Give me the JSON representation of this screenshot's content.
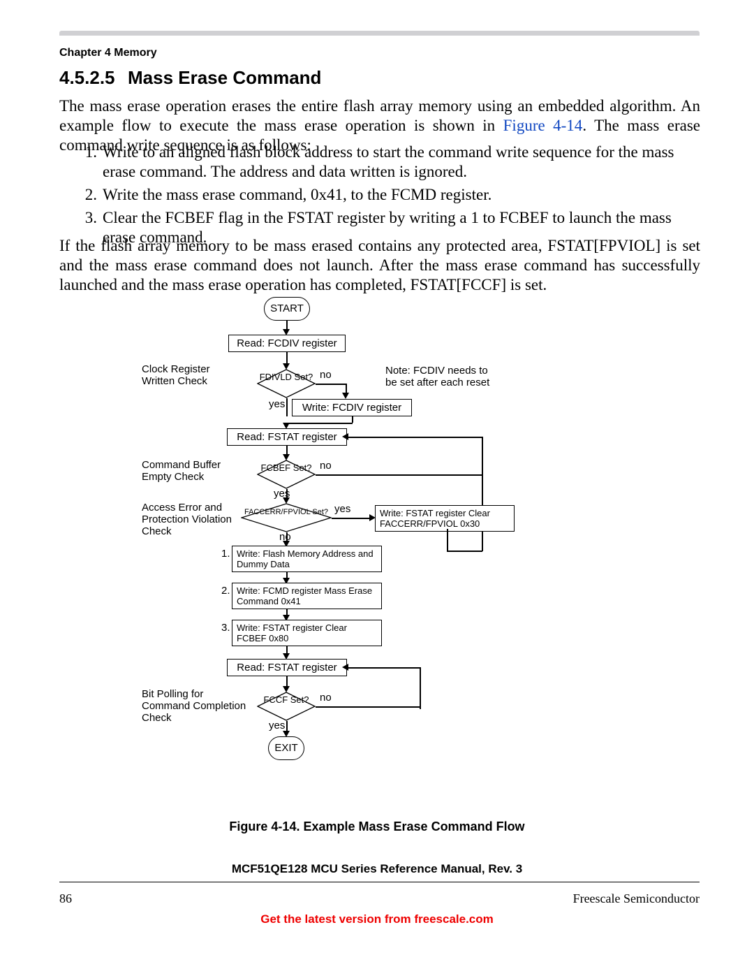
{
  "chapter_header": "Chapter 4 Memory",
  "section": {
    "number": "4.5.2.5",
    "title": "Mass Erase Command"
  },
  "para1_a": "The mass erase operation erases the entire flash array memory using an embedded algorithm. An example flow to execute the mass erase operation is shown in ",
  "para1_figref": "Figure 4-14",
  "para1_b": ". The mass erase command write sequence is as follows:",
  "list": {
    "1": "Write to an aligned flash block address to start the command write sequence for the mass erase command. The address and data written is ignored.",
    "2": "Write the mass erase command, 0x41, to the FCMD register.",
    "3": "Clear the FCBEF flag in the FSTAT register by writing a 1 to FCBEF to launch the mass erase command."
  },
  "para2": "If the flash array memory to be mass erased contains any protected area, FSTAT[FPVIOL] is set and the mass erase command does not launch. After the mass erase command has successfully launched and the mass erase operation has completed, FSTAT[FCCF] is set.",
  "flow": {
    "start": "START",
    "exit": "EXIT",
    "read_fcdiv": "Read: FCDIV register",
    "fdivld": "FDIVLD Set?",
    "yes": "yes",
    "no": "no",
    "write_fcdiv": "Write: FCDIV register",
    "read_fstat": "Read: FSTAT register",
    "fcbef": "FCBEF Set?",
    "faccerr": "FACCERR/FPVIOL Set?",
    "write_fstat_clear": "Write: FSTAT register Clear FACCERR/FPVIOL 0x30",
    "step1": "Write: Flash Memory Address and Dummy Data",
    "step2": "Write: FCMD register Mass Erase Command 0x41",
    "step3": "Write: FSTAT register Clear FCBEF 0x80",
    "read_fstat2": "Read: FSTAT register",
    "fccf": "FCCF Set?",
    "side_clock": "Clock Register Written Check",
    "side_cmdbuf": "Command Buffer Empty Check",
    "side_access": "Access Error and Protection Violation Check",
    "side_bitpoll": "Bit Polling for Command Completion Check",
    "note": "Note: FCDIV needs to be set after each reset",
    "n1": "1.",
    "n2": "2.",
    "n3": "3."
  },
  "figure_caption": "Figure 4-14. Example Mass Erase Command Flow",
  "manual_title": "MCF51QE128 MCU Series Reference Manual, Rev. 3",
  "page_number": "86",
  "brand": "Freescale Semiconductor",
  "get_latest": "Get the latest version from freescale.com"
}
